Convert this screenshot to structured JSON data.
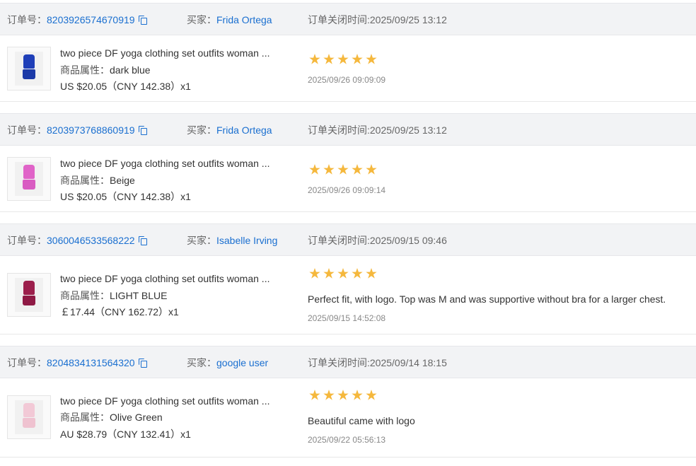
{
  "labels": {
    "order_no": "订单号：",
    "buyer": "买家：",
    "close_time": "订单关闭时间:",
    "attr": "商品属性："
  },
  "colors": {
    "link": "#1a6fd0",
    "star": "#f5b83d",
    "header_bg": "#f2f3f5"
  },
  "orders": [
    {
      "order_no": "8203926574670919",
      "buyer": "Frida Ortega",
      "close_time": "2025/09/25 13:12",
      "product_title": "two piece DF yoga clothing set outfits woman ...",
      "attr_value": "dark blue",
      "price": "US $20.05（CNY  142.38）x1",
      "rating": 5,
      "review": "",
      "review_time": "2025/09/26 09:09:09",
      "image_icon": "blue-yoga-set-thumbnail"
    },
    {
      "order_no": "8203973768860919",
      "buyer": "Frida Ortega",
      "close_time": "2025/09/25 13:12",
      "product_title": "two piece DF yoga clothing set outfits woman ...",
      "attr_value": "Beige",
      "price": "US $20.05（CNY  142.38）x1",
      "rating": 5,
      "review": "",
      "review_time": "2025/09/26 09:09:14",
      "image_icon": "pink-yoga-set-thumbnail"
    },
    {
      "order_no": "3060046533568222",
      "buyer": "Isabelle Irving",
      "close_time": "2025/09/15 09:46",
      "product_title": "two piece DF yoga clothing set outfits woman ...",
      "attr_value": "LIGHT BLUE",
      "price": "￡17.44（CNY  162.72）x1",
      "rating": 5,
      "review": "Perfect fit, with logo. Top was M and was supportive without bra for a larger chest.",
      "review_time": "2025/09/15 14:52:08",
      "image_icon": "burgundy-yoga-set-thumbnail"
    },
    {
      "order_no": "8204834131564320",
      "buyer": "google user",
      "close_time": "2025/09/14 18:15",
      "product_title": "two piece DF yoga clothing set outfits woman ...",
      "attr_value": "Olive Green",
      "price": "AU $28.79（CNY  132.41）x1",
      "rating": 5,
      "review": "Beautiful came with logo",
      "review_time": "2025/09/22 05:56:13",
      "image_icon": "light-pink-yoga-set-thumbnail"
    }
  ]
}
